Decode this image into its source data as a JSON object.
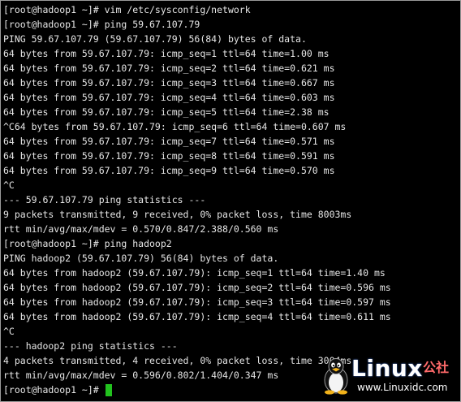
{
  "terminal": {
    "lines": [
      "[root@hadoop1 ~]# vim /etc/sysconfig/network",
      "[root@hadoop1 ~]# ping 59.67.107.79",
      "PING 59.67.107.79 (59.67.107.79) 56(84) bytes of data.",
      "64 bytes from 59.67.107.79: icmp_seq=1 ttl=64 time=1.00 ms",
      "64 bytes from 59.67.107.79: icmp_seq=2 ttl=64 time=0.621 ms",
      "64 bytes from 59.67.107.79: icmp_seq=3 ttl=64 time=0.667 ms",
      "64 bytes from 59.67.107.79: icmp_seq=4 ttl=64 time=0.603 ms",
      "64 bytes from 59.67.107.79: icmp_seq=5 ttl=64 time=2.38 ms",
      "^C64 bytes from 59.67.107.79: icmp_seq=6 ttl=64 time=0.607 ms",
      "64 bytes from 59.67.107.79: icmp_seq=7 ttl=64 time=0.571 ms",
      "64 bytes from 59.67.107.79: icmp_seq=8 ttl=64 time=0.591 ms",
      "64 bytes from 59.67.107.79: icmp_seq=9 ttl=64 time=0.570 ms",
      "^C",
      "--- 59.67.107.79 ping statistics ---",
      "9 packets transmitted, 9 received, 0% packet loss, time 8003ms",
      "rtt min/avg/max/mdev = 0.570/0.847/2.388/0.560 ms",
      "[root@hadoop1 ~]# ping hadoop2",
      "PING hadoop2 (59.67.107.79) 56(84) bytes of data.",
      "64 bytes from hadoop2 (59.67.107.79): icmp_seq=1 ttl=64 time=1.40 ms",
      "64 bytes from hadoop2 (59.67.107.79): icmp_seq=2 ttl=64 time=0.596 ms",
      "64 bytes from hadoop2 (59.67.107.79): icmp_seq=3 ttl=64 time=0.597 ms",
      "64 bytes from hadoop2 (59.67.107.79): icmp_seq=4 ttl=64 time=0.611 ms",
      "^C",
      "--- hadoop2 ping statistics ---",
      "4 packets transmitted, 4 received, 0% packet loss, time 3004ms",
      "rtt min/avg/max/mdev = 0.596/0.802/1.404/0.347 ms"
    ],
    "prompt": "[root@hadoop1 ~]# "
  },
  "watermark": {
    "brand": "Linux",
    "suffix": "公社",
    "domain": "www.Linuxidc.com"
  },
  "colors": {
    "background": "#000000",
    "text": "#e6e6e6",
    "cursor": "#22c21e"
  },
  "icons": {
    "logo": "tux-penguin-icon"
  }
}
